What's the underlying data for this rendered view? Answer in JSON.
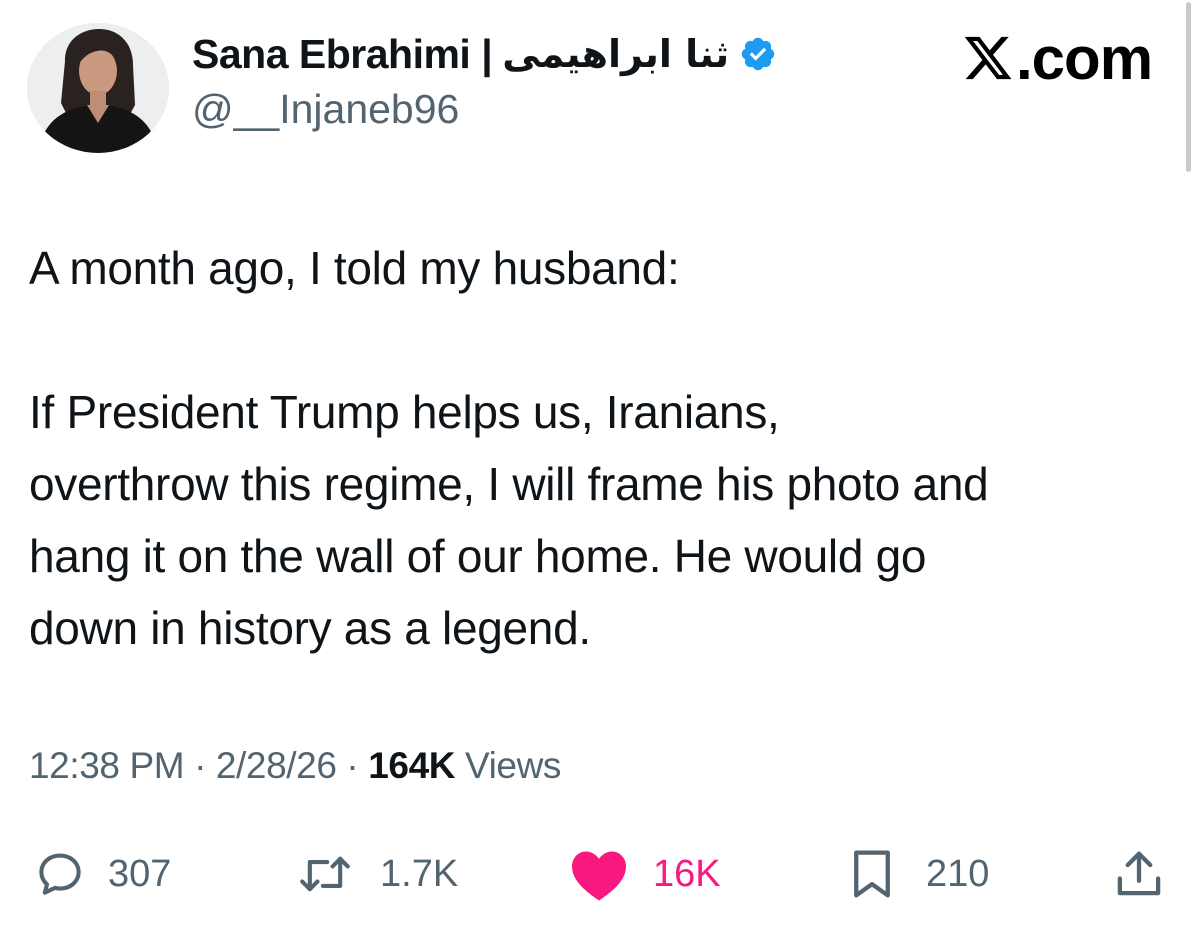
{
  "author": {
    "display_name": "Sana Ebrahimi |",
    "display_name_fa": "ثنا ابراهیمی",
    "handle": "@__Injaneb96",
    "verified": true,
    "avatar_icon": "profile-photo"
  },
  "brand": {
    "label": ".com",
    "logo_icon": "x-logo-icon"
  },
  "tweet": {
    "paragraph_1": "A month ago, I told my husband:",
    "paragraph_2": "If President Trump helps us, Iranians,\noverthrow this regime, I will frame his photo and\nhang it on the wall of our home. He would go\ndown in history as a legend."
  },
  "meta": {
    "time": "12:38 PM",
    "separator": "·",
    "date": "2/28/26",
    "views_count": "164K",
    "views_label": "Views"
  },
  "actions": {
    "replies": {
      "icon": "reply-icon",
      "count": "307"
    },
    "reposts": {
      "icon": "repost-icon",
      "count": "1.7K"
    },
    "likes": {
      "icon": "heart-icon",
      "count": "16K",
      "liked": true
    },
    "bookmarks": {
      "icon": "bookmark-icon",
      "count": "210"
    },
    "share": {
      "icon": "share-icon"
    }
  },
  "colors": {
    "text_primary": "#0f1419",
    "text_secondary": "#536471",
    "verified_blue": "#1d9bf0",
    "like_pink": "#f91880"
  }
}
